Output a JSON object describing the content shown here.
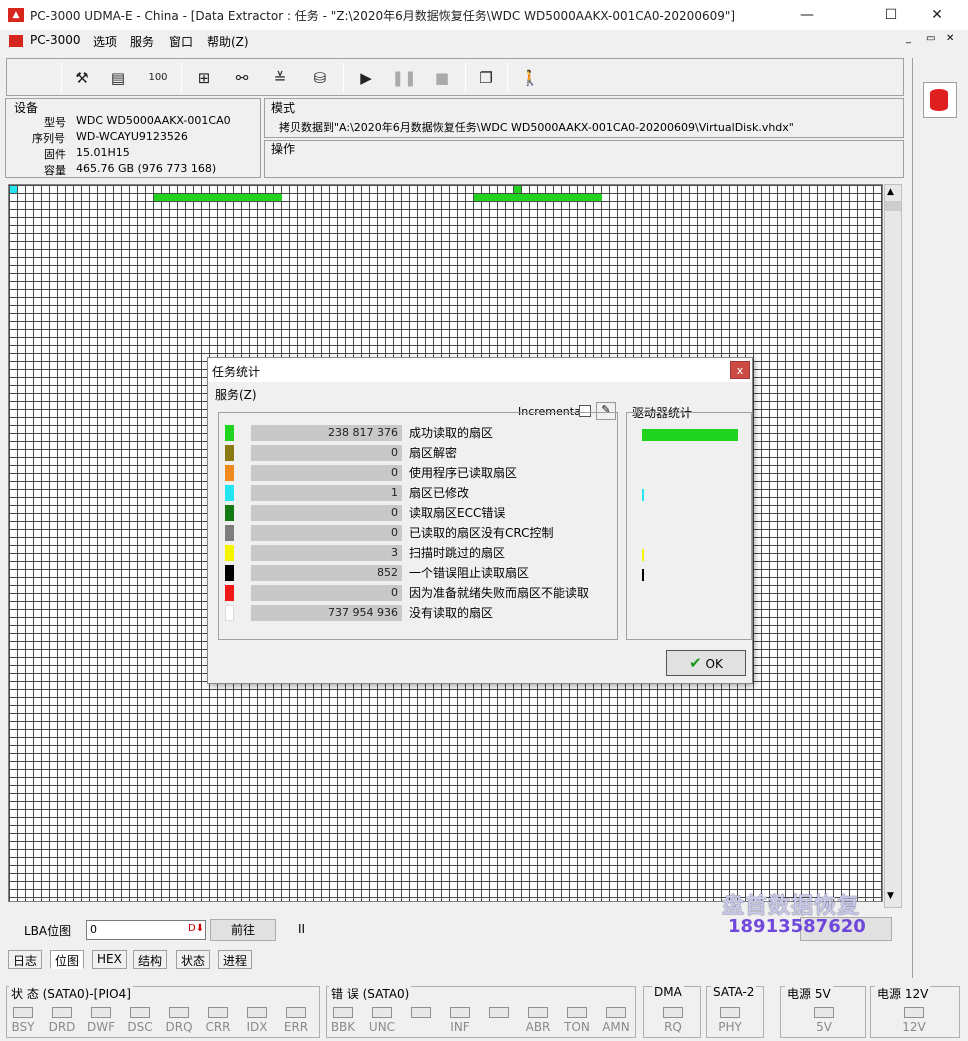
{
  "window": {
    "title": "PC-3000 UDMA-E - China - [Data Extractor : 任务 - \"Z:\\2020年6月数据恢复任务\\WDC WD5000AAKX-001CA0-20200609\"]",
    "minimize": "—",
    "maximize": "☐",
    "close": "✕"
  },
  "menu": [
    "PC-3000",
    "选项",
    "服务",
    "窗口",
    "帮助(Z)"
  ],
  "mdi_buttons": [
    "_",
    "▭",
    "✕"
  ],
  "toolbar": {
    "icons": [
      "tools-icon",
      "id-icon",
      "percent-icon",
      "tree-icon",
      "binoculars-icon",
      "scan-icon",
      "disk-icon",
      "play-icon",
      "pause-icon",
      "stop-icon",
      "copy-icon",
      "exit-icon"
    ]
  },
  "device": {
    "header": "设备",
    "model_label": "型号",
    "model": "WDC WD5000AAKX-001CA0",
    "serial_label": "序列号",
    "serial": "WD-WCAYU9123526",
    "firmware_label": "固件",
    "firmware": "15.01H15",
    "capacity_label": "容量",
    "capacity": "465.76 GB (976 773 168)"
  },
  "mode": {
    "header": "模式",
    "text": "拷贝数据到\"A:\\2020年6月数据恢复任务\\WDC WD5000AAKX-001CA0-20200609\\VirtualDisk.vhdx\""
  },
  "operation": {
    "header": "操作"
  },
  "lba": {
    "label": "LBA位图",
    "value": "0",
    "goto_button": "前往",
    "pause_glyph": "II"
  },
  "tabs": [
    "日志",
    "位图",
    "HEX",
    "结构",
    "状态",
    "进程"
  ],
  "status": {
    "state_group": "状 态 (SATA0)-[PIO4]",
    "state_leds": [
      "BSY",
      "DRD",
      "DWF",
      "DSC",
      "DRQ",
      "CRR",
      "IDX",
      "ERR"
    ],
    "error_group": "错 误 (SATA0)",
    "error_leds": [
      "BBK",
      "UNC",
      "",
      "INF",
      "",
      "ABR",
      "TON",
      "AMN"
    ],
    "dma_group": "DMA",
    "dma_leds": [
      "RQ"
    ],
    "sata_group": "SATA-2",
    "sata_leds": [
      "PHY"
    ],
    "p5_group": "电源 5V",
    "p5_leds": [
      "5V"
    ],
    "p12_group": "电源 12V",
    "p12_leds": [
      "12V"
    ]
  },
  "dialog": {
    "title": "任务统计",
    "close": "x",
    "menu": "服务(Z)",
    "incremental": "Incremental",
    "drive_stats": "驱动器统计",
    "ok": "OK",
    "rows": [
      {
        "color": "#1fd31f",
        "value": "238 817 376",
        "label": "成功读取的扇区"
      },
      {
        "color": "#8b7a12",
        "value": "0",
        "label": "扇区解密"
      },
      {
        "color": "#f08a1e",
        "value": "0",
        "label": "使用程序已读取扇区"
      },
      {
        "color": "#22e6f0",
        "value": "1",
        "label": "扇区已修改"
      },
      {
        "color": "#137a13",
        "value": "0",
        "label": "读取扇区ECC错误"
      },
      {
        "color": "#7e7e7e",
        "value": "0",
        "label": "已读取的扇区没有CRC控制"
      },
      {
        "color": "#f5f500",
        "value": "3",
        "label": "扫描时跳过的扇区"
      },
      {
        "color": "#000000",
        "value": "852",
        "label": "一个错误阻止读取扇区"
      },
      {
        "color": "#f01818",
        "value": "0",
        "label": "因为准备就绪失败而扇区不能读取"
      },
      {
        "color": "#ffffff",
        "value": "737 954 936",
        "label": "没有读取的扇区"
      }
    ]
  },
  "watermark": {
    "line1": "盘首数据恢复",
    "line2": "18913587620"
  }
}
